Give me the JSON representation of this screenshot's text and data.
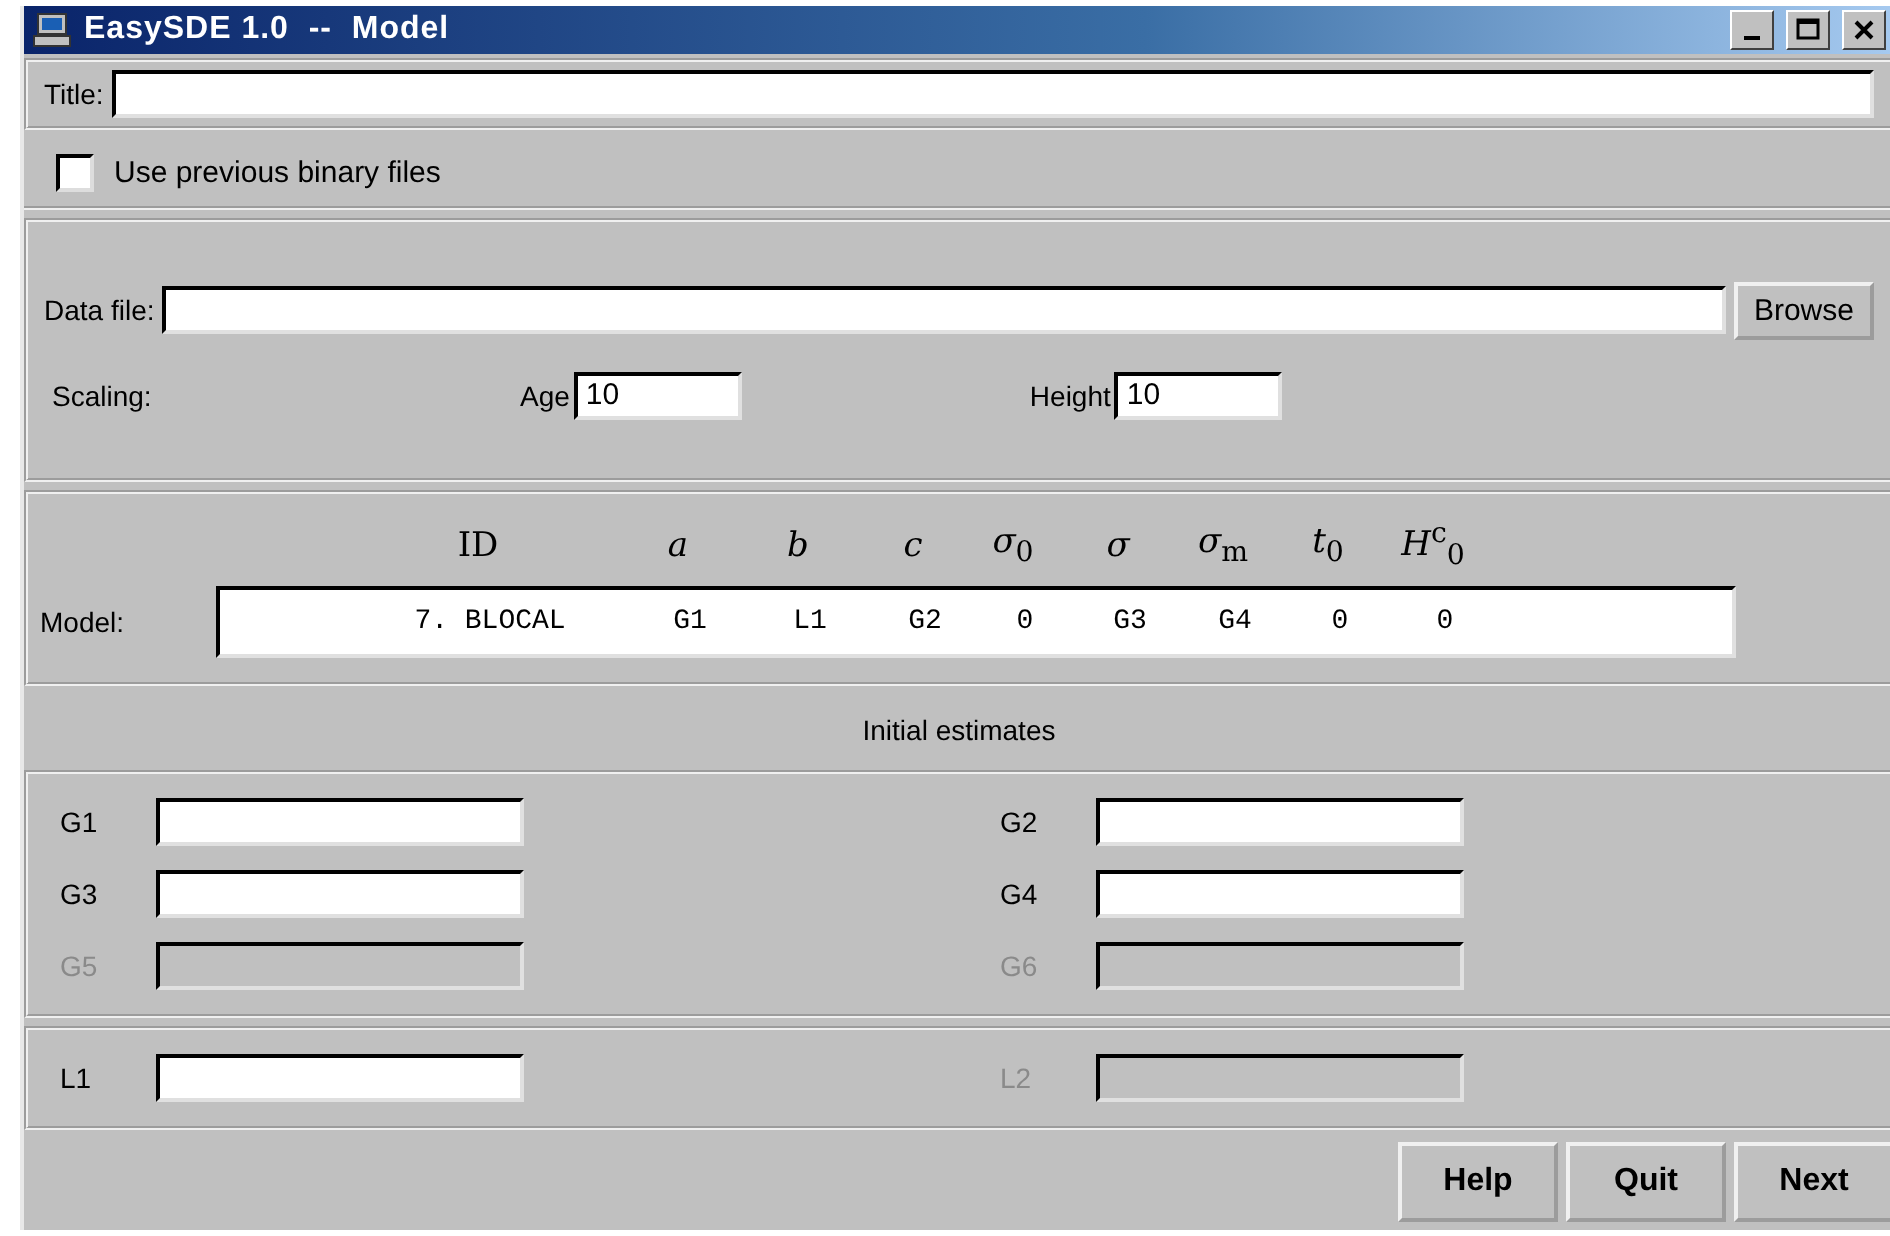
{
  "window": {
    "title": "EasySDE 1.0  --  Model"
  },
  "title_field": {
    "label": "Title:"
  },
  "use_previous": {
    "label": "Use previous binary files",
    "checked": false
  },
  "data_file": {
    "label": "Data file:",
    "button": "Browse"
  },
  "scaling": {
    "label": "Scaling:",
    "fields": [
      {
        "label": "Age",
        "value": "10"
      },
      {
        "label": "Height",
        "value": "10"
      }
    ]
  },
  "model": {
    "label": "Model:",
    "headers": [
      "ID",
      "*a*",
      "*b*",
      "*c*",
      "*σ*$_{0}$",
      "*σ*",
      "*σ*$_{m}$",
      "*t*$_{0}$",
      "*H*$^{c}$$_{0}$"
    ],
    "values": [
      "7. BLOCAL",
      "G1",
      "L1",
      "G2",
      "0",
      "G3",
      "G4",
      "0",
      "0"
    ]
  },
  "initial_estimates": {
    "title": "Initial estimates",
    "groups": [
      [
        {
          "label": "G1",
          "disabled": false
        },
        {
          "label": "G2",
          "disabled": false
        },
        {
          "label": "G3",
          "disabled": false
        },
        {
          "label": "G4",
          "disabled": false
        },
        {
          "label": "G5",
          "disabled": true
        },
        {
          "label": "G6",
          "disabled": true
        }
      ],
      [
        {
          "label": "L1",
          "disabled": false
        },
        {
          "label": "L2",
          "disabled": true
        }
      ]
    ]
  },
  "buttons": [
    "Help",
    "Quit",
    "Next"
  ]
}
